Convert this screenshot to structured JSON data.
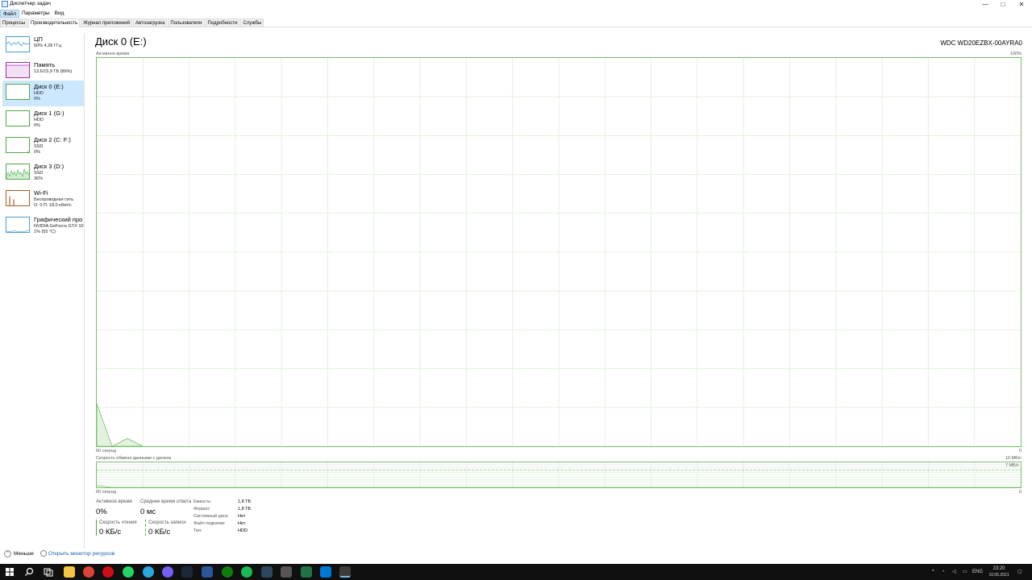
{
  "window": {
    "title": "Диспетчер задач",
    "min": "—",
    "max": "□",
    "close": "✕"
  },
  "menu": [
    "Файл",
    "Параметры",
    "Вид"
  ],
  "tabs": [
    "Процессы",
    "Производительность",
    "Журнал приложений",
    "Автозагрузка",
    "Пользователи",
    "Подробности",
    "Службы"
  ],
  "sidebar": {
    "items": [
      {
        "name": "ЦП",
        "l1": "60% 4,28 ГГц",
        "l2": "",
        "l3": "",
        "color": "#4a9bd4"
      },
      {
        "name": "Память",
        "l1": "13,6/15,9 ГБ (86%)",
        "l2": "",
        "l3": "",
        "color": "#a02ab1"
      },
      {
        "name": "Диск 0 (E:)",
        "l1": "HDD",
        "l2": "0%",
        "l3": "",
        "color": "#4da847"
      },
      {
        "name": "Диск 1 (G:)",
        "l1": "HDD",
        "l2": "0%",
        "l3": "",
        "color": "#4da847"
      },
      {
        "name": "Диск 2 (C: F:)",
        "l1": "SSD",
        "l2": "0%",
        "l3": "",
        "color": "#4da847"
      },
      {
        "name": "Диск 3 (D:)",
        "l1": "SSD",
        "l2": "36%",
        "l3": "",
        "color": "#4da847"
      },
      {
        "name": "Wi-Fi",
        "l1": "Беспроводная сеть",
        "l2": "О: 0 П: 18,0 кбит/с",
        "l3": "",
        "color": "#a75c1f"
      },
      {
        "name": "Графический про",
        "l1": "NVIDIA GeForce GTX 10",
        "l2": "1% (55 °C)",
        "l3": "",
        "color": "#4a9bd4"
      }
    ]
  },
  "main": {
    "title": "Диск 0 (E:)",
    "model": "WDC WD20EZBX-00AYRA0",
    "active_time_label": "Активное время",
    "active_time_max": "100%",
    "seconds_label": "60 секунд",
    "zero": "0",
    "transfer_label": "Скорость обмена данными с диском",
    "transfer_max": "10 МБ/с",
    "transfer_mid": "7 МБ/с"
  },
  "chart_data": {
    "type": "area",
    "active_time_percent_last_points": [
      11,
      0,
      2,
      0
    ],
    "ylim": [
      0,
      100
    ]
  },
  "stats": {
    "active_time_label": "Активное время",
    "active_time_value": "0%",
    "avg_response_label": "Среднее время ответа",
    "avg_response_value": "0 мс",
    "read_label": "Скорость чтения",
    "read_value": "0 КБ/с",
    "write_label": "Скорость записи",
    "write_value": "0 КБ/с"
  },
  "properties": [
    {
      "label": "Емкость:",
      "value": "1,8 ТБ"
    },
    {
      "label": "Формат:",
      "value": "1,8 ТБ"
    },
    {
      "label": "Системный диск:",
      "value": "Нет"
    },
    {
      "label": "Файл подкачки:",
      "value": "Нет"
    },
    {
      "label": "Тип:",
      "value": "HDD"
    }
  ],
  "footer": {
    "less": "Меньше",
    "monitor": "Открыть монитор ресурсов",
    "chevron": "^"
  },
  "taskbar": {
    "lang": "ENG",
    "time": "23:20",
    "date": "10.05.2021",
    "apps": [
      "windows-start",
      "search",
      "task-view",
      "file-explorer",
      "chrome",
      "opera",
      "whatsapp",
      "telegram",
      "viber",
      "steam",
      "word",
      "xbox",
      "spotify",
      "steam-2",
      "settings",
      "excel",
      "mail",
      "task-manager"
    ]
  }
}
